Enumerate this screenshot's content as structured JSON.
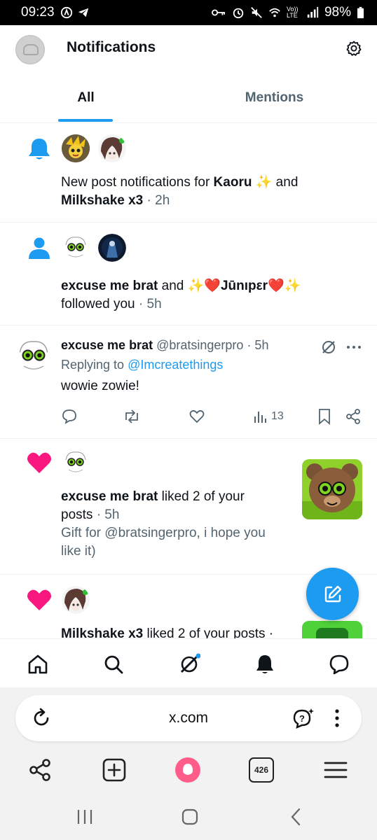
{
  "status_bar": {
    "time": "09:23",
    "battery": "98%",
    "network": "Vo)) LTE"
  },
  "header": {
    "title": "Notifications"
  },
  "tabs": [
    {
      "label": "All",
      "active": true
    },
    {
      "label": "Mentions",
      "active": false
    }
  ],
  "notifications": {
    "post_alert": {
      "text_prefix": "New post notifications for ",
      "name1": "Kaoru",
      "name1_emoji": "✨",
      "connector": " and",
      "name2": "Milkshake x3",
      "time": " · 2h"
    },
    "follow": {
      "name1": "excuse me brat",
      "connector": " and ",
      "name2": "✨❤️Jūnıpεr❤️✨",
      "action": "followed you",
      "time": " · 5h"
    },
    "reply_tweet": {
      "name": "excuse me brat",
      "handle": "@bratsingerpro",
      "time": " · 5h",
      "replying_label": "Replying to ",
      "replying_to": "@Imcreatethings",
      "body": "wowie zowie!",
      "views": "13"
    },
    "like1": {
      "name": "excuse me brat",
      "action_line1": " liked 2 of your",
      "action_line2": "posts",
      "time": " · 5h",
      "snippet_line1": "Gift for @bratsingerpro, i hope you",
      "snippet_line2": "like it)"
    },
    "like2": {
      "name": "Milkshake x3",
      "action": " liked 2 of your posts ·"
    }
  },
  "browser": {
    "url": "x.com",
    "tabs_count": "426"
  },
  "colors": {
    "accent": "#1d9bf0",
    "like": "#f91880",
    "muted": "#536471"
  }
}
